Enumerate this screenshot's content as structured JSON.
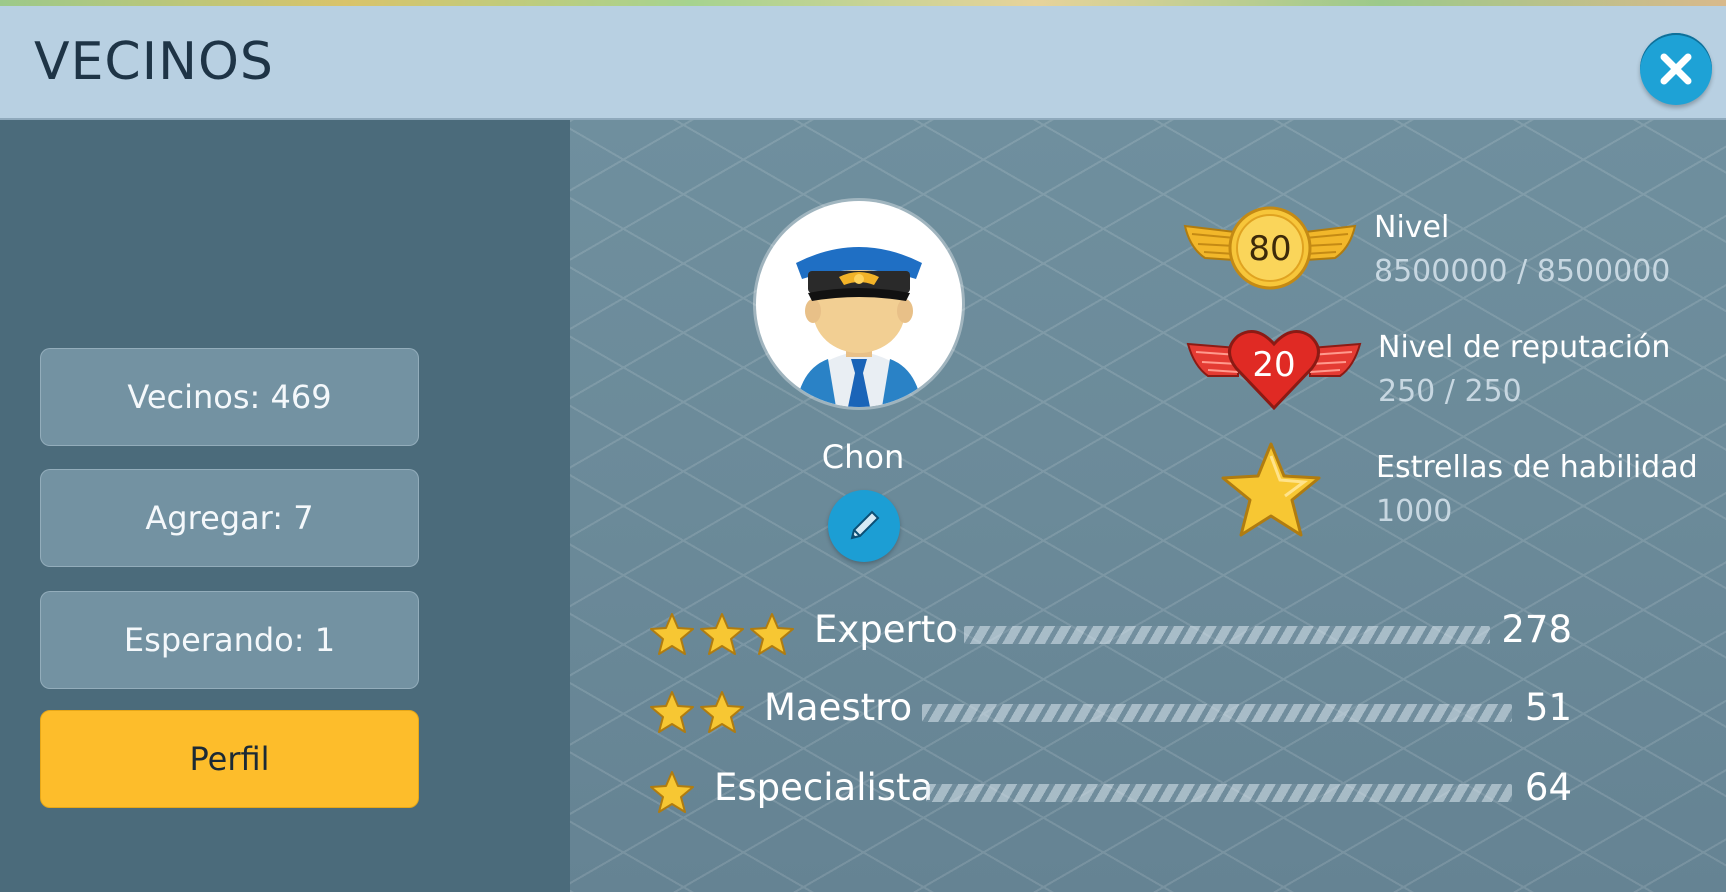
{
  "header": {
    "title": "VECINOS",
    "close_icon": "close-icon"
  },
  "sidebar": {
    "items": [
      {
        "label": "Vecinos: 469",
        "active": false
      },
      {
        "label": "Agregar: 7",
        "active": false
      },
      {
        "label": "Esperando: 1",
        "active": false
      },
      {
        "label": "Perfil",
        "active": true
      }
    ]
  },
  "profile": {
    "name": "Chon",
    "avatar_icon": "pilot-avatar-icon",
    "edit_icon": "pencil-icon",
    "stats": [
      {
        "icon": "winged-level-badge-icon",
        "badge": "80",
        "label": "Nivel",
        "value": "8500000 / 8500000"
      },
      {
        "icon": "winged-heart-reputation-icon",
        "badge": "20",
        "label": "Nivel de reputación",
        "value": "250 / 250"
      },
      {
        "icon": "gold-star-icon",
        "badge": "",
        "label": "Estrellas de habilidad",
        "value": "1000"
      }
    ],
    "ranks": [
      {
        "stars": 3,
        "label": "Experto",
        "count": "278"
      },
      {
        "stars": 2,
        "label": "Maestro",
        "count": "51"
      },
      {
        "stars": 1,
        "label": "Especialista",
        "count": "64"
      }
    ]
  },
  "colors": {
    "header_bg": "#b8d0e2",
    "sidebar_bg": "#4b6b7b",
    "active_tab": "#fdbd2b",
    "accent_blue": "#1ea2d6"
  }
}
